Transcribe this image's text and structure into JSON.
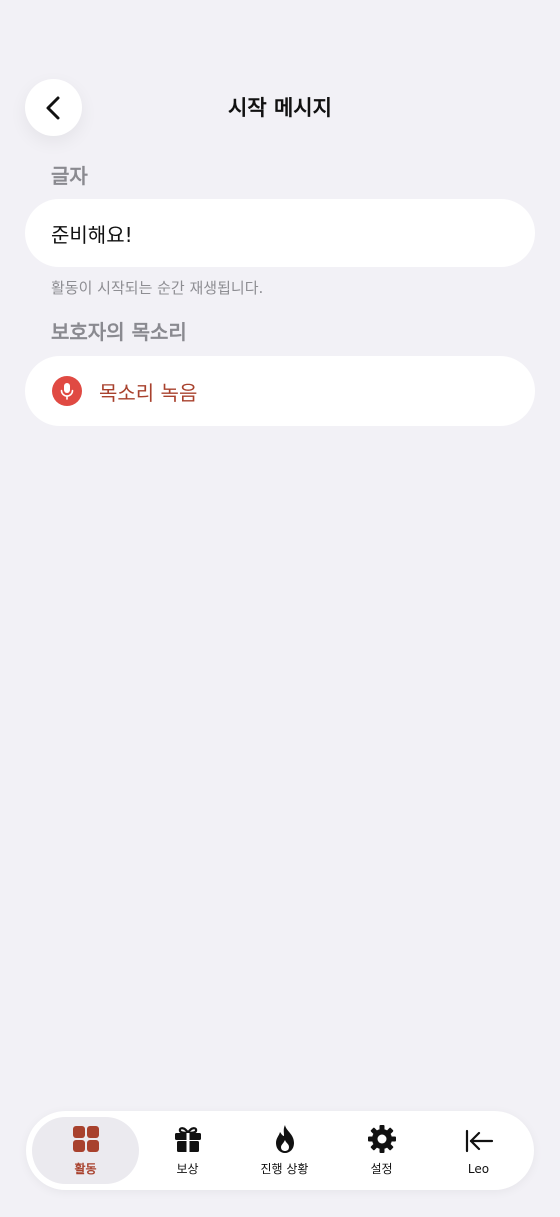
{
  "header": {
    "title": "시작 메시지"
  },
  "sections": {
    "text_label": "글자",
    "text_value": "준비해요!",
    "text_helper": "활동이 시작되는 순간 재생됩니다.",
    "voice_label": "보호자의 목소리",
    "record_label": "목소리 녹음"
  },
  "tabs": [
    {
      "label": "활동",
      "icon": "grid-icon",
      "active": true
    },
    {
      "label": "보상",
      "icon": "gift-icon",
      "active": false
    },
    {
      "label": "진행 상황",
      "icon": "flame-icon",
      "active": false
    },
    {
      "label": "설정",
      "icon": "gear-icon",
      "active": false
    },
    {
      "label": "Leo",
      "icon": "arrow-left-bar-icon",
      "active": false
    }
  ],
  "colors": {
    "background": "#f2f1f6",
    "accent": "#a8412d",
    "mic": "#e04a43"
  }
}
